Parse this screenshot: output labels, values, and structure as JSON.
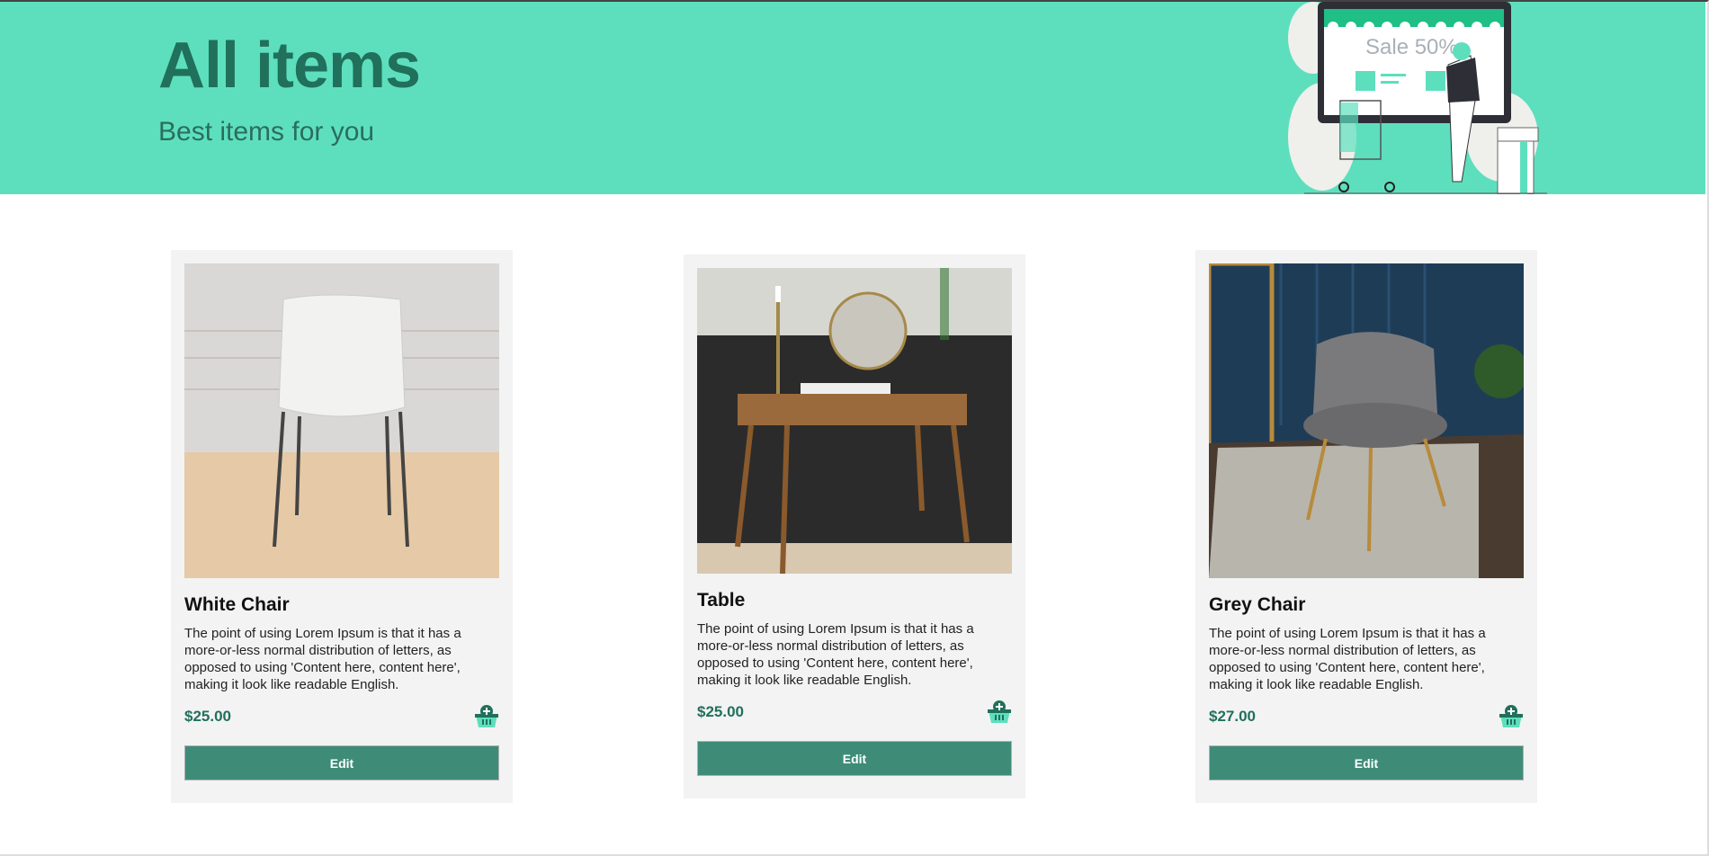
{
  "header": {
    "title": "All items",
    "subtitle": "Best items for you",
    "illustration_text": "Sale 50%"
  },
  "colors": {
    "accent": "#5ddfbe",
    "dark_green": "#20705b",
    "button": "#3e8c78",
    "card_bg": "#f3f3f3"
  },
  "items": [
    {
      "name": "White Chair",
      "description": "The point of using Lorem Ipsum is that it has a more-or-less normal distribution of letters, as opposed to using 'Content here, content here', making it look like readable English.",
      "price": "$25.00",
      "button": "Edit"
    },
    {
      "name": "Table",
      "description": "The point of using Lorem Ipsum is that it has a more-or-less normal distribution of letters, as opposed to using 'Content here, content here', making it look like readable English.",
      "price": "$25.00",
      "button": "Edit"
    },
    {
      "name": "Grey Chair",
      "description": "The point of using Lorem Ipsum is that it has a more-or-less normal distribution of letters, as opposed to using 'Content here, content here', making it look like readable English.",
      "price": "$27.00",
      "button": "Edit"
    }
  ]
}
